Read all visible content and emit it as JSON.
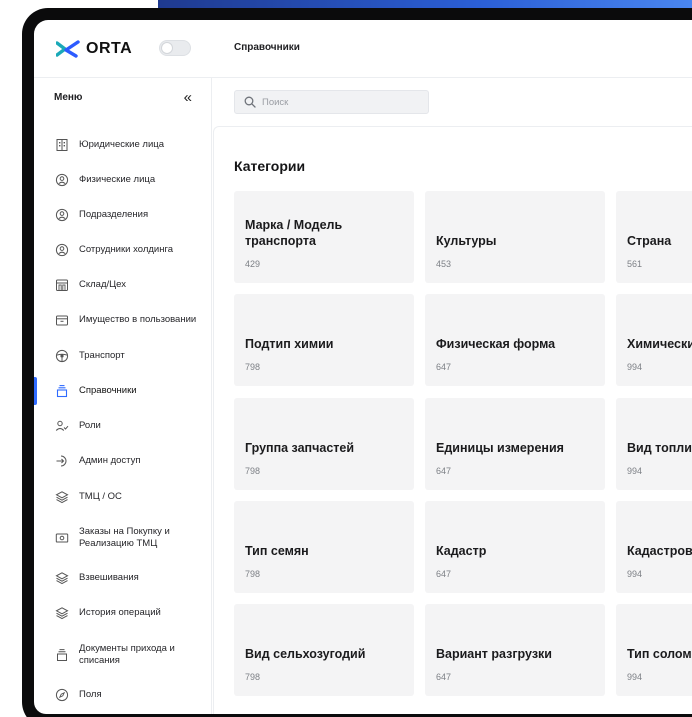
{
  "brand": {
    "logo_text": "ORTA",
    "accent_color": "#2f6bff",
    "logo_colors": [
      "#1aa9b8",
      "#2d5bff"
    ]
  },
  "header": {
    "title": "Справочники"
  },
  "sidebar": {
    "menu_title": "Меню",
    "collapse_icon": "«",
    "active_index": 7,
    "items": [
      {
        "label": "Юридические лица",
        "icon": "building-icon"
      },
      {
        "label": "Физические лица",
        "icon": "person-circle-icon"
      },
      {
        "label": "Подразделения",
        "icon": "person-circle-icon"
      },
      {
        "label": "Сотрудники холдинга",
        "icon": "person-circle-icon"
      },
      {
        "label": "Склад/Цех",
        "icon": "warehouse-icon"
      },
      {
        "label": "Имущество в пользовании",
        "icon": "archive-icon"
      },
      {
        "label": "Транспорт",
        "icon": "steering-wheel-icon"
      },
      {
        "label": "Справочники",
        "icon": "stack-icon"
      },
      {
        "label": "Роли",
        "icon": "user-check-icon"
      },
      {
        "label": "Админ доступ",
        "icon": "login-icon"
      },
      {
        "label": "ТМЦ / ОС",
        "icon": "layers-icon"
      },
      {
        "label": "Заказы на Покупку и Реализацию ТМЦ",
        "icon": "money-icon"
      },
      {
        "label": "Взвешивания",
        "icon": "layers-icon"
      },
      {
        "label": "История операций",
        "icon": "layers-icon"
      },
      {
        "label": "Документы прихода и списания",
        "icon": "stack-icon"
      },
      {
        "label": "Поля",
        "icon": "compass-icon"
      }
    ]
  },
  "search": {
    "placeholder": "Поиск"
  },
  "main": {
    "title": "Категории",
    "cards": [
      {
        "name": "Марка / Модель транспорта",
        "count": "429"
      },
      {
        "name": "Культуры",
        "count": "453"
      },
      {
        "name": "Страна",
        "count": "561"
      },
      {
        "name": "Подтип химии",
        "count": "798"
      },
      {
        "name": "Физическая форма",
        "count": "647"
      },
      {
        "name": "Химически",
        "count": "994"
      },
      {
        "name": "Группа запчастей",
        "count": "798"
      },
      {
        "name": "Единицы измерения",
        "count": "647"
      },
      {
        "name": "Вид топлив",
        "count": "994"
      },
      {
        "name": "Тип семян",
        "count": "798"
      },
      {
        "name": "Кадастр",
        "count": "647"
      },
      {
        "name": "Кадастров",
        "count": "994"
      },
      {
        "name": "Вид сельхозугодий",
        "count": "798"
      },
      {
        "name": "Вариант разгрузки",
        "count": "647"
      },
      {
        "name": "Тип солом",
        "count": "994"
      }
    ]
  }
}
